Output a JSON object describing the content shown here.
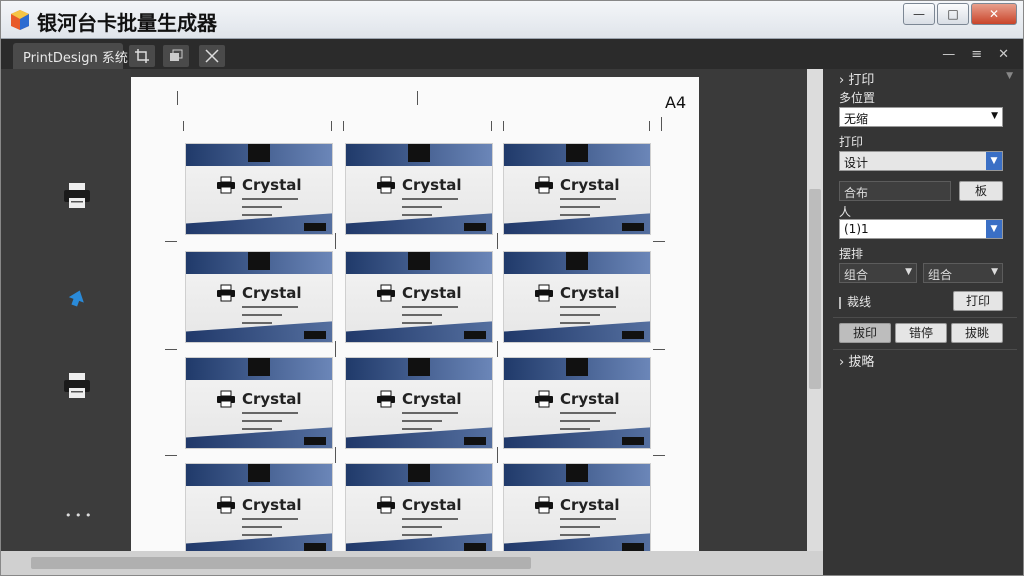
{
  "window": {
    "title": "银河台卡批量生成器",
    "controls": {
      "minimize": "—",
      "maximize": "□",
      "close": "✕"
    }
  },
  "tabs": {
    "active_label": "PrintDesign 系统",
    "right_icons": [
      "—",
      "≡",
      "✕"
    ]
  },
  "page": {
    "size_label": "A4",
    "card_name": "Crystal",
    "rows": 4,
    "cols": 3
  },
  "left_tools": [
    {
      "icon": "printer-icon"
    },
    {
      "icon": "arrow-icon"
    },
    {
      "icon": "printer-icon"
    },
    {
      "label": "• • •"
    }
  ],
  "panel": {
    "section_print": "打印",
    "label_position": "多位置",
    "position_value": "无缩",
    "label_print": "打印",
    "print_value": "设计",
    "gap_label": "合布",
    "gap_button": "板",
    "size_label": "人",
    "size_value": "(1)1",
    "align_label": "摆排",
    "align_left": "组合",
    "align_right": "组合",
    "check_label": "裁线",
    "check_button": "打印",
    "btn_layout": "拔印",
    "btn_order": "错停",
    "btn_export": "拔眺",
    "section_more": "拔略"
  },
  "colors": {
    "accent": "#3a6fc5",
    "card_band_dark": "#203a6a",
    "card_band_light": "#6b86b8"
  }
}
